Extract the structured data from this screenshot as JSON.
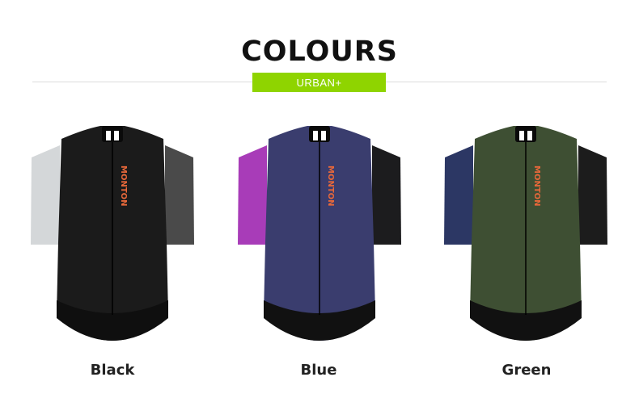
{
  "heading": "COLOURS",
  "badge": "URBAN+",
  "products": [
    {
      "label": "Black",
      "colors": {
        "body": "#1b1b1b",
        "left_sleeve": "#d4d7d9",
        "right_sleeve": "#4a4a4a",
        "hem": "#0f0f0f"
      }
    },
    {
      "label": "Blue",
      "colors": {
        "body": "#3a3d6e",
        "left_sleeve": "#a83cb8",
        "right_sleeve": "#1c1c1e",
        "hem": "#111111"
      }
    },
    {
      "label": "Green",
      "colors": {
        "body": "#3e4f33",
        "left_sleeve": "#2c3764",
        "right_sleeve": "#1c1c1c",
        "hem": "#111111"
      }
    }
  ],
  "brand_mark": "MONTON",
  "accent_color": "#e8683a"
}
